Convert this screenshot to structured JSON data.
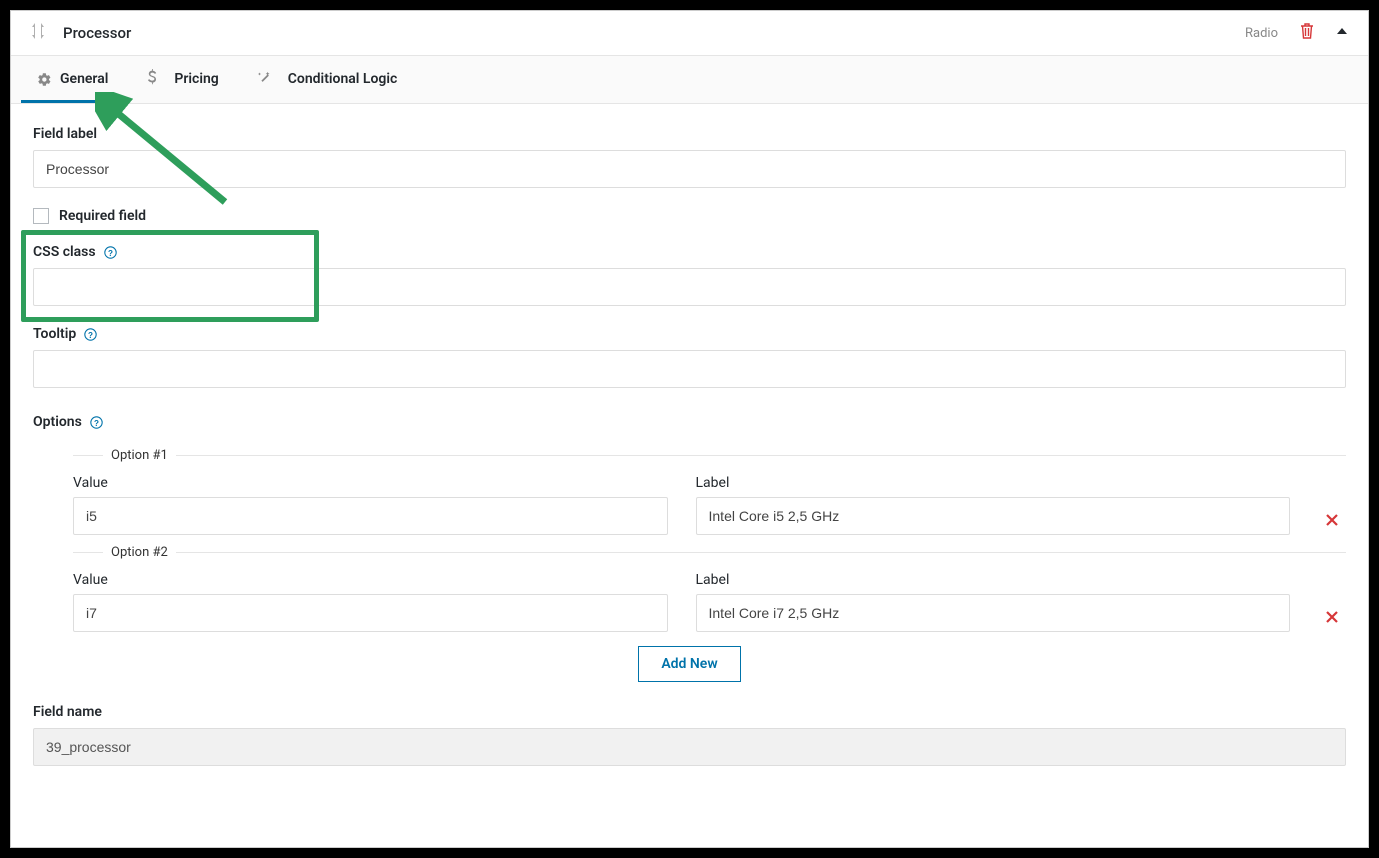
{
  "header": {
    "title": "Processor",
    "type_label": "Radio"
  },
  "tabs": {
    "general": "General",
    "pricing": "Pricing",
    "conditional": "Conditional Logic"
  },
  "form": {
    "field_label": {
      "label": "Field label",
      "value": "Processor"
    },
    "required": {
      "label": "Required field",
      "checked": false
    },
    "css_class": {
      "label": "CSS class",
      "value": ""
    },
    "tooltip": {
      "label": "Tooltip",
      "value": ""
    },
    "options_label": "Options",
    "options": [
      {
        "title": "Option #1",
        "value_label": "Value",
        "value": "i5",
        "label_label": "Label",
        "label": "Intel Core i5 2,5 GHz"
      },
      {
        "title": "Option #2",
        "value_label": "Value",
        "value": "i7",
        "label_label": "Label",
        "label": "Intel Core i7 2,5 GHz"
      }
    ],
    "add_new": "Add New",
    "field_name": {
      "label": "Field name",
      "value": "39_processor"
    }
  }
}
